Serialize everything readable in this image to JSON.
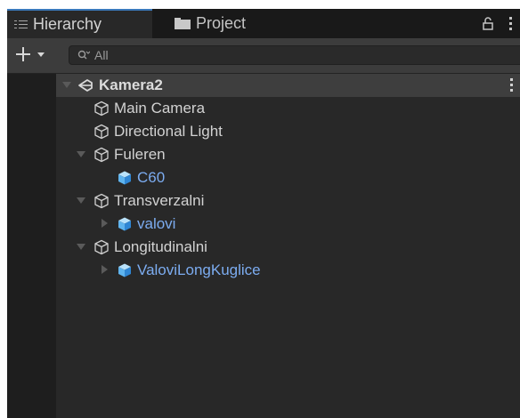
{
  "tabs": [
    {
      "label": "Hierarchy",
      "icon": "list-icon",
      "active": true
    },
    {
      "label": "Project",
      "icon": "folder-icon",
      "active": false
    }
  ],
  "toolbar": {
    "search_placeholder": "All"
  },
  "scene": {
    "label": "Kamera2",
    "icon": "unity-scene-icon"
  },
  "items": [
    {
      "label": "Main Camera",
      "icon": "gameobject-cube-icon",
      "type": "gameobject"
    },
    {
      "label": "Directional Light",
      "icon": "gameobject-cube-icon",
      "type": "gameobject"
    },
    {
      "label": "Fuleren",
      "icon": "gameobject-cube-icon",
      "type": "gameobject",
      "expanded": true
    },
    {
      "label": "C60",
      "icon": "prefab-cube-icon",
      "type": "prefab"
    },
    {
      "label": "Transverzalni",
      "icon": "gameobject-cube-icon",
      "type": "gameobject",
      "expanded": true
    },
    {
      "label": "valovi",
      "icon": "prefab-cube-icon",
      "type": "prefab",
      "expanded": false
    },
    {
      "label": "Longitudinalni",
      "icon": "gameobject-cube-icon",
      "type": "gameobject",
      "expanded": true
    },
    {
      "label": "ValoviLongKuglice",
      "icon": "prefab-cube-icon",
      "type": "prefab",
      "expanded": false
    }
  ],
  "colors": {
    "panel_bg": "#282828",
    "prefab_text": "#7cacf0",
    "selected_row": "#3e3e3e",
    "tab_accent": "#3a79bb"
  }
}
